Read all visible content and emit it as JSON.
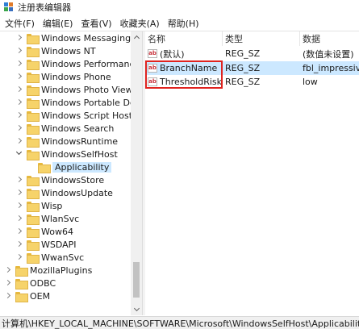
{
  "window": {
    "title": "注册表编辑器",
    "app_icon": "registry-editor-icon"
  },
  "menu": [
    "文件(F)",
    "编辑(E)",
    "查看(V)",
    "收藏夹(A)",
    "帮助(H)"
  ],
  "tree": {
    "items": [
      {
        "label": "Windows Messaging Su",
        "expander": "collapsed"
      },
      {
        "label": "Windows NT",
        "expander": "collapsed"
      },
      {
        "label": "Windows Performance T",
        "expander": "collapsed"
      },
      {
        "label": "Windows Phone",
        "expander": "collapsed"
      },
      {
        "label": "Windows Photo Viewer",
        "expander": "collapsed"
      },
      {
        "label": "Windows Portable Devi",
        "expander": "collapsed"
      },
      {
        "label": "Windows Script Host",
        "expander": "collapsed"
      },
      {
        "label": "Windows Search",
        "expander": "collapsed"
      },
      {
        "label": "WindowsRuntime",
        "expander": "collapsed"
      },
      {
        "label": "WindowsSelfHost",
        "expander": "expanded"
      },
      {
        "label": "Applicability",
        "expander": "none",
        "selected": true
      },
      {
        "label": "WindowsStore",
        "expander": "collapsed"
      },
      {
        "label": "WindowsUpdate",
        "expander": "collapsed"
      },
      {
        "label": "Wisp",
        "expander": "collapsed"
      },
      {
        "label": "WlanSvc",
        "expander": "collapsed"
      },
      {
        "label": "Wow64",
        "expander": "collapsed"
      },
      {
        "label": "WSDAPI",
        "expander": "collapsed"
      },
      {
        "label": "WwanSvc",
        "expander": "collapsed"
      },
      {
        "label": "MozillaPlugins",
        "expander": "collapsed"
      },
      {
        "label": "ODBC",
        "expander": "collapsed"
      },
      {
        "label": "OEM",
        "expander": "collapsed"
      }
    ]
  },
  "list": {
    "headers": [
      "名称",
      "类型",
      "数据"
    ],
    "rows": [
      {
        "name": "(默认)",
        "type": "REG_SZ",
        "data": "(数值未设置)",
        "icon": "string-value-icon"
      },
      {
        "name": "BranchName",
        "type": "REG_SZ",
        "data": "fbl_impressive",
        "icon": "string-value-icon"
      },
      {
        "name": "ThresholdRisk...",
        "type": "REG_SZ",
        "data": "low",
        "icon": "string-value-icon"
      }
    ]
  },
  "status": {
    "path": "计算机\\HKEY_LOCAL_MACHINE\\SOFTWARE\\Microsoft\\WindowsSelfHost\\Applicability"
  },
  "colors": {
    "selection": "#cce8ff",
    "annotation_box": "#e0231f",
    "folder": "#f6d36a"
  }
}
